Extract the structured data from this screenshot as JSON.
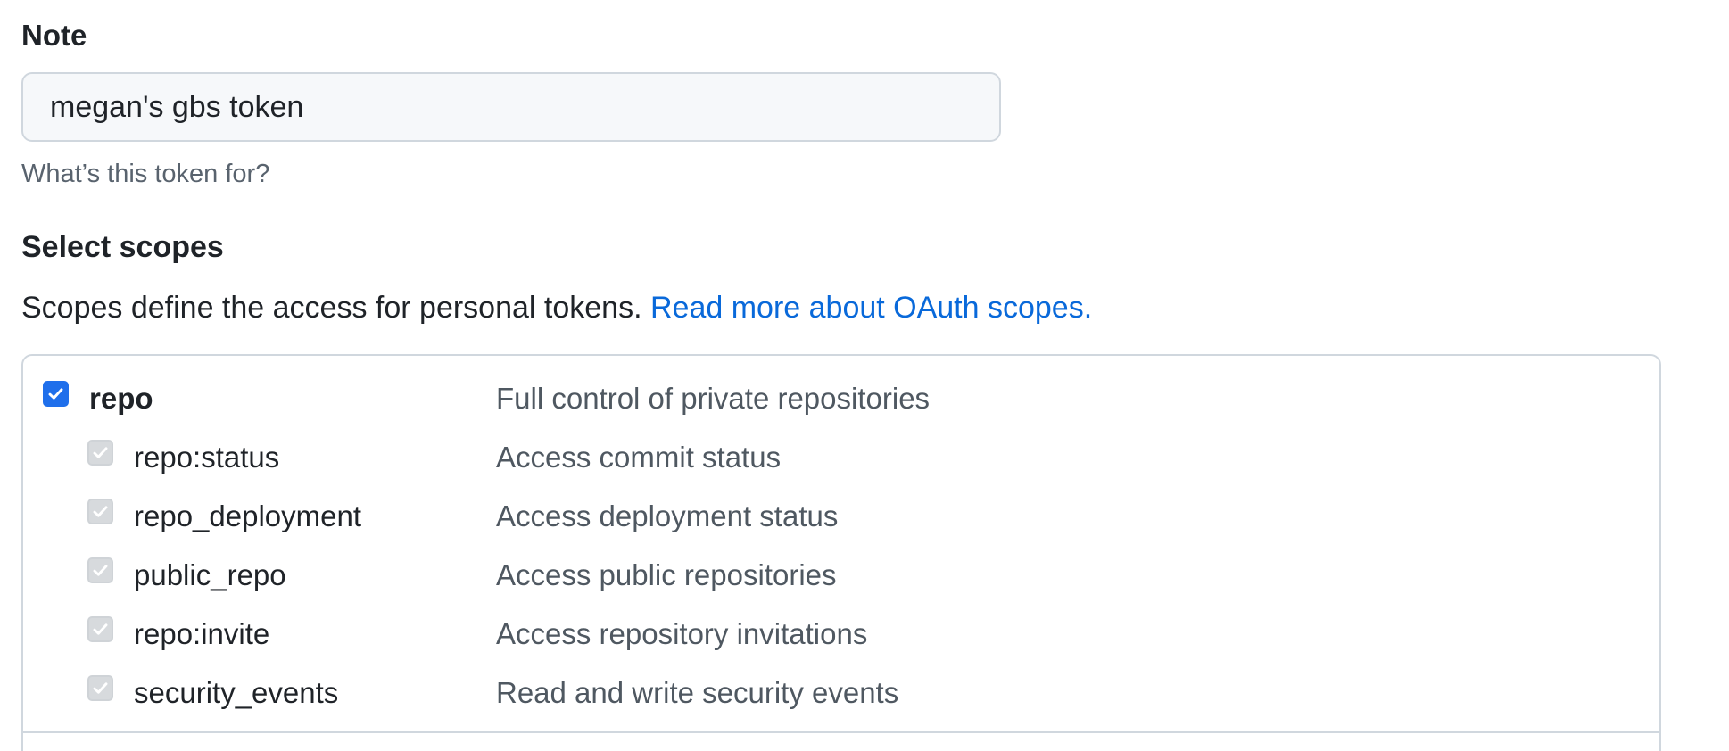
{
  "note": {
    "label": "Note",
    "value": "megan's gbs token",
    "hint": "What’s this token for?"
  },
  "scopes": {
    "heading": "Select scopes",
    "description": "Scopes define the access for personal tokens.",
    "link_text": "Read more about OAuth scopes.",
    "parent": {
      "name": "repo",
      "description": "Full control of private repositories",
      "checked": true
    },
    "children": [
      {
        "name": "repo:status",
        "description": "Access commit status",
        "checked": true,
        "disabled": true
      },
      {
        "name": "repo_deployment",
        "description": "Access deployment status",
        "checked": true,
        "disabled": true
      },
      {
        "name": "public_repo",
        "description": "Access public repositories",
        "checked": true,
        "disabled": true
      },
      {
        "name": "repo:invite",
        "description": "Access repository invitations",
        "checked": true,
        "disabled": true
      },
      {
        "name": "security_events",
        "description": "Read and write security events",
        "checked": true,
        "disabled": true
      }
    ]
  },
  "colors": {
    "accent": "#1f6feb",
    "link": "#0969da",
    "muted": "#59636e",
    "border": "#d0d7de"
  }
}
